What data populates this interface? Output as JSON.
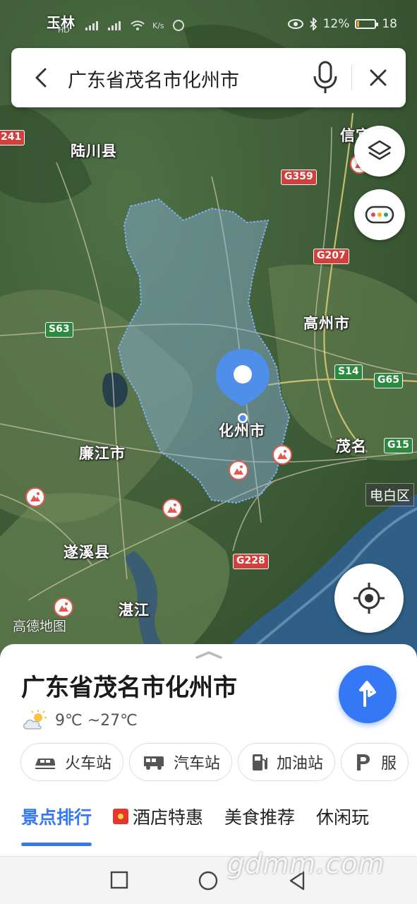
{
  "status_bar": {
    "carrier": "玉林",
    "network": "HD",
    "speed": "K/s",
    "battery_text": "12%",
    "battery_level": 0.12,
    "time": "18"
  },
  "search": {
    "query": "广东省茂名市化州市"
  },
  "map": {
    "places": [
      {
        "id": "luchuan",
        "name": "陆川县"
      },
      {
        "id": "gaozhou",
        "name": "高州市"
      },
      {
        "id": "lianjiang",
        "name": "廉江市"
      },
      {
        "id": "suixi",
        "name": "遂溪县"
      },
      {
        "id": "zhanjiang",
        "name": "湛江"
      },
      {
        "id": "maoming",
        "name": "茂名"
      },
      {
        "id": "huazhou",
        "name": "化州市"
      },
      {
        "id": "xinyi",
        "name": "信宜"
      }
    ],
    "roads": [
      {
        "id": "g359",
        "code": "G359",
        "color": "#d3403b"
      },
      {
        "id": "g207",
        "code": "G207",
        "color": "#d3403b"
      },
      {
        "id": "s63",
        "code": "S63",
        "color": "#2b8a3e"
      },
      {
        "id": "s14",
        "code": "S14",
        "color": "#2b8a3e"
      },
      {
        "id": "g65",
        "code": "G65",
        "color": "#2b8a3e"
      },
      {
        "id": "g15",
        "code": "G15",
        "color": "#2b8a3e"
      },
      {
        "id": "g228",
        "code": "G228",
        "color": "#d3403b"
      },
      {
        "id": "s241",
        "code": "241",
        "color": "#d3403b"
      }
    ],
    "district": "电白区",
    "brand": "高德地图"
  },
  "sheet": {
    "title": "广东省茂名市化州市",
    "weather": "9℃ ~27℃",
    "chips": [
      {
        "label": "火车站",
        "icon": "train-icon"
      },
      {
        "label": "汽车站",
        "icon": "bus-icon"
      },
      {
        "label": "加油站",
        "icon": "gas-station-icon"
      },
      {
        "label": "服",
        "icon": "parking-icon"
      }
    ],
    "tabs": [
      {
        "label": "景点排行",
        "active": true
      },
      {
        "label": "酒店特惠",
        "active": false
      },
      {
        "label": "美食推荐",
        "active": false
      },
      {
        "label": "休闲玩",
        "active": false
      }
    ]
  },
  "watermark": "gdmm.com",
  "colors": {
    "accent": "#3478f6",
    "region_fill": "#8fb8e8",
    "road_red": "#d3403b",
    "road_green": "#2b8a3e"
  }
}
